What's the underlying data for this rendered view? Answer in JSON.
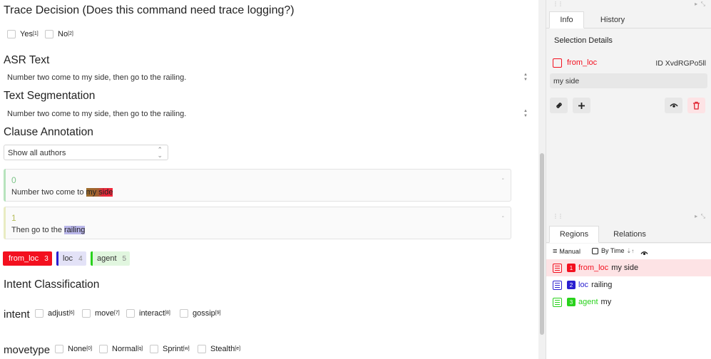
{
  "trace": {
    "title": "Trace Decision (Does this command need trace logging?)",
    "options": [
      {
        "label": "Yes",
        "key": "[1]"
      },
      {
        "label": "No",
        "key": "[2]"
      }
    ]
  },
  "asr": {
    "title": "ASR Text",
    "text": "Number two come to my side, then go to the railing."
  },
  "segmentation": {
    "title": "Text Segmentation",
    "text": "Number two come to my side, then go to the railing."
  },
  "clause": {
    "title": "Clause Annotation",
    "author_select": "Show all authors",
    "items": [
      {
        "index": "0",
        "prefix": "Number two come to ",
        "highlight": "my side",
        "suffix": "",
        "dash": "-"
      },
      {
        "index": "1",
        "prefix": "Then go to the ",
        "highlight": "railing",
        "suffix": "",
        "dash": "-"
      }
    ],
    "labels": [
      {
        "name": "from_loc",
        "count": "3",
        "color": "#f3101f"
      },
      {
        "name": "loc",
        "count": "4",
        "color": "#2a1fd0"
      },
      {
        "name": "agent",
        "count": "5",
        "color": "#28d21c"
      }
    ]
  },
  "intent": {
    "title": "Intent Classification",
    "group_label": "intent",
    "options": [
      {
        "label": "adjust",
        "key": "[6]"
      },
      {
        "label": "move",
        "key": "[7]"
      },
      {
        "label": "interact",
        "key": "[8]"
      },
      {
        "label": "gossip",
        "key": "[9]"
      }
    ],
    "movetype_label": "movetype",
    "movetype_options": [
      {
        "label": "None",
        "key": "[0]"
      },
      {
        "label": "Normal",
        "key": "[q]"
      },
      {
        "label": "Sprint",
        "key": "[w]"
      },
      {
        "label": "Stealth",
        "key": "[e]"
      }
    ]
  },
  "info_panel": {
    "tabs": [
      "Info",
      "History"
    ],
    "active_tab": "Info",
    "section_title": "Selection Details",
    "region_label": "from_loc",
    "region_color": "#f3101f",
    "id_text": "ID XvdRGPo5ll",
    "region_text": "my side",
    "icons": [
      "link-icon",
      "plus-icon",
      "eye-icon",
      "trash-icon"
    ]
  },
  "regions_panel": {
    "tabs": [
      "Regions",
      "Relations"
    ],
    "active_tab": "Regions",
    "toolbar": {
      "manual": "Manual",
      "by_time": "By Time"
    },
    "rows": [
      {
        "num": "1",
        "label": "from_loc",
        "text": "my side",
        "color": "#f3101f",
        "selected": true
      },
      {
        "num": "2",
        "label": "loc",
        "text": "railing",
        "color": "#2a1fd0",
        "selected": false
      },
      {
        "num": "3",
        "label": "agent",
        "text": "my",
        "color": "#28d21c",
        "selected": false
      }
    ]
  },
  "colors": {
    "clause0_bar": "#b7e3bd",
    "clause0_index": "#7dc589",
    "clause1_bar": "#e9ecc2",
    "clause1_index": "#b5bd5a",
    "selected_row_bg": "#fde3e5"
  }
}
